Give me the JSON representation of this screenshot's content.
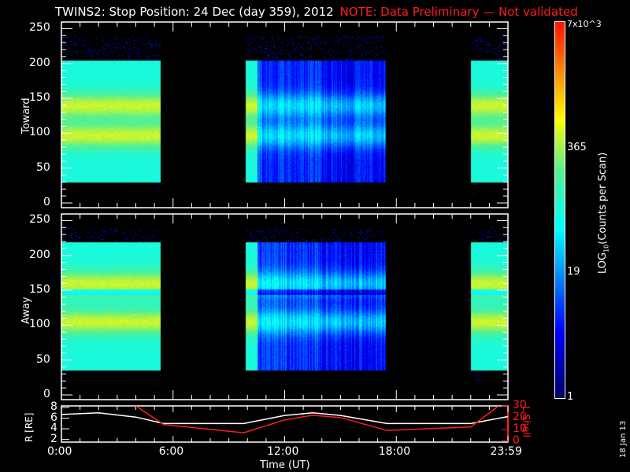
{
  "title": "TWINS2: Stop Position: 24 Dec (day 359), 2012",
  "warning": "NOTE: Data Preliminary — Not validated",
  "datestamp": "18 Jan 13",
  "chart_data": [
    {
      "type": "heatmap",
      "name": "Toward",
      "ylabel": "Toward",
      "xlim_hours": [
        0,
        24
      ],
      "ylim": [
        0,
        255
      ],
      "yticks": [
        "0",
        "50",
        "100",
        "150",
        "200",
        "250"
      ],
      "data_segments_hours": [
        [
          0,
          5.3
        ],
        [
          9.9,
          17.4
        ],
        [
          22.0,
          24
        ]
      ],
      "bright_bands_y": [
        140,
        97
      ],
      "cutoff_low": 30,
      "cutoff_high": 205
    },
    {
      "type": "heatmap",
      "name": "Away",
      "ylabel": "Away",
      "xlim_hours": [
        0,
        24
      ],
      "ylim": [
        0,
        255
      ],
      "yticks": [
        "0",
        "50",
        "100",
        "150",
        "200",
        "250"
      ],
      "data_segments_hours": [
        [
          0,
          5.3
        ],
        [
          9.9,
          17.4
        ],
        [
          22.0,
          24
        ]
      ],
      "bright_bands_y": [
        160,
        105
      ],
      "cutoff_low": 35,
      "cutoff_high": 220
    },
    {
      "type": "line",
      "ylabel": "R [RE]",
      "y2label": "L Shell",
      "xlabel": "Time (UT)",
      "xticks": [
        "0:00",
        "6:00",
        "12:00",
        "18:00",
        "23:59"
      ],
      "yticks": [
        "2",
        "4",
        "6",
        "8"
      ],
      "y2ticks": [
        "0",
        "10",
        "20",
        "30"
      ],
      "ylim": [
        1.5,
        8.3
      ],
      "y2lim": [
        -1,
        30
      ],
      "series": [
        {
          "name": "R",
          "color": "#ffffff",
          "x": [
            0,
            2,
            4,
            5.5,
            9.8,
            12,
            13.5,
            15,
            17.5,
            22,
            24
          ],
          "y": [
            6.7,
            7.0,
            6.2,
            5.0,
            5.0,
            6.5,
            7.0,
            6.5,
            5.0,
            5.0,
            6.3
          ]
        },
        {
          "name": "L Shell",
          "color": "#ff1e1e",
          "x": [
            4,
            5.5,
            9.8,
            12,
            13.5,
            15,
            17.5,
            22,
            23.5
          ],
          "y": [
            30,
            14,
            7,
            18,
            22,
            20,
            9,
            12,
            30
          ]
        }
      ]
    }
  ],
  "colorbar": {
    "label": "LOG10(Counts per Scan)",
    "ticks": [
      "1",
      "19",
      "365",
      "7x10^3"
    ],
    "tick_display": {
      "mantissa": "7x",
      "base": "10",
      "exp": "3"
    },
    "label_parts": {
      "pre": "LOG",
      "sub": "10",
      "post": "(Counts per Scan)"
    },
    "range": [
      1,
      7000
    ]
  }
}
